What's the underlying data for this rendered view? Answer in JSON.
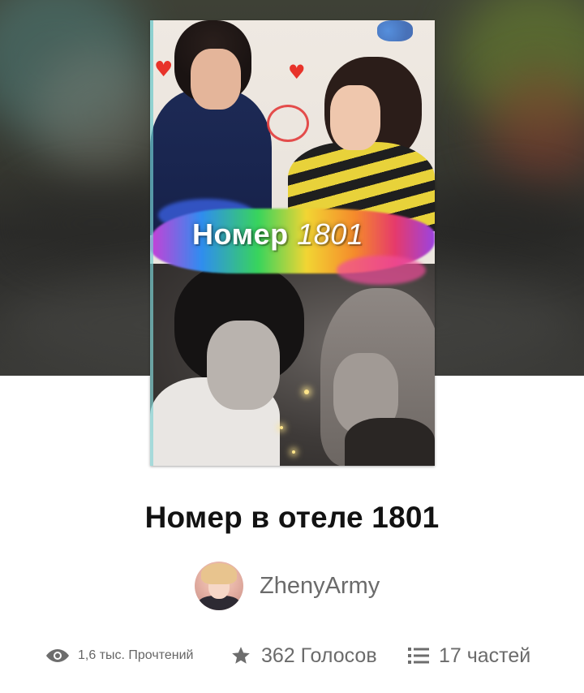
{
  "story": {
    "cover": {
      "title_word": "Номер",
      "title_number": "1801"
    },
    "title": "Номер в отеле 1801",
    "author": {
      "name": "ZhenyArmy"
    },
    "stats": {
      "reads": "1,6 тыс. Прочтений",
      "votes": "362 Голосов",
      "parts": "17 частей"
    }
  },
  "icons": {
    "reads": "eye-icon",
    "votes": "star-icon",
    "parts": "list-icon"
  },
  "colors": {
    "icon_gray": "#6d6d6d",
    "title_text": "#121212",
    "meta_text": "#6b6b6b",
    "heart_red": "#e8332a"
  }
}
